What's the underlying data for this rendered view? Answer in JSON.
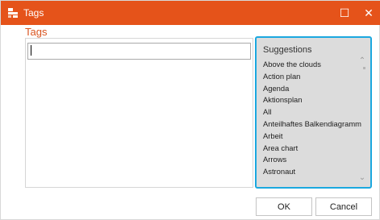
{
  "window": {
    "title": "Tags",
    "maximize_glyph": "☐",
    "close_glyph": "✕",
    "icon": "tags-app-icon"
  },
  "tags": {
    "label": "Tags",
    "input_value": ""
  },
  "suggestions": {
    "header": "Suggestions",
    "items": [
      "Above the clouds",
      "Action plan",
      "Agenda",
      "Aktionsplan",
      "All",
      "Anteilhaftes Balkendiagramm",
      "Arbeit",
      "Area chart",
      "Arrows",
      "Astronaut"
    ],
    "scroll_up_glyph": "⌃",
    "scroll_down_glyph": "⌄"
  },
  "buttons": {
    "ok": "OK",
    "cancel": "Cancel"
  },
  "colors": {
    "titlebar": "#e5531a",
    "accent_label": "#d9541f",
    "focus_border": "#1ba8df",
    "suggestions_bg": "#dcdcdc"
  }
}
